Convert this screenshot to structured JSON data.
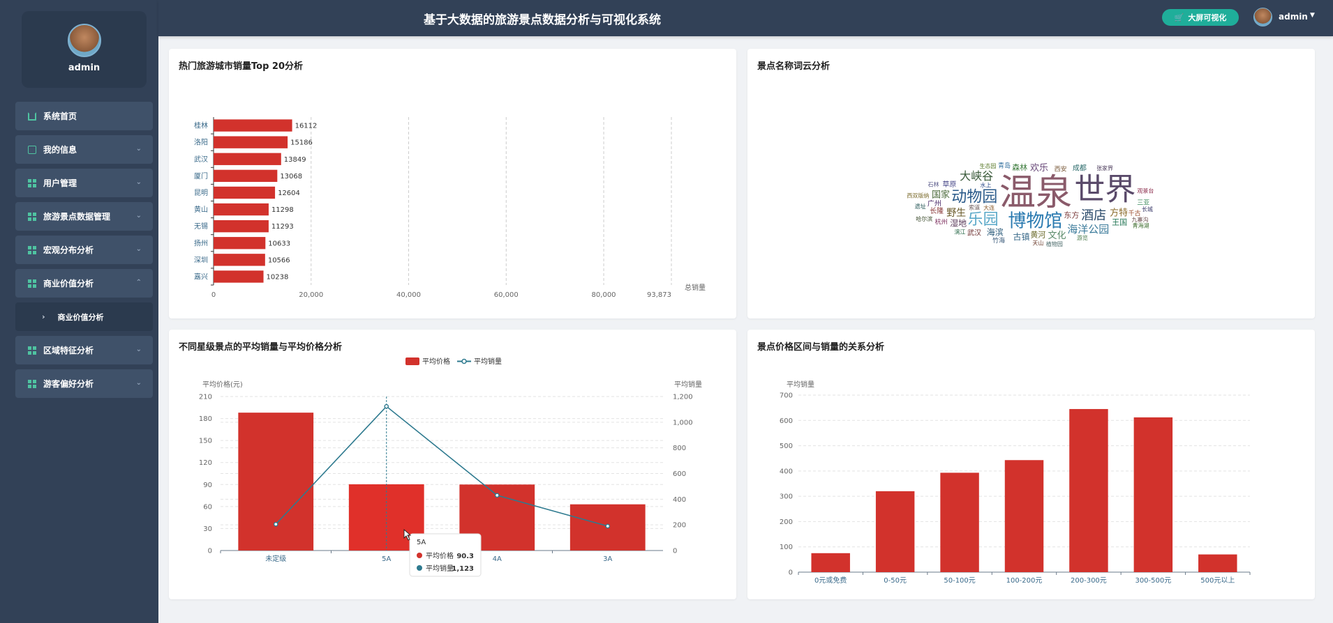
{
  "header": {
    "title": "基于大数据的旅游景点数据分析与可视化系统",
    "bigscreen_label": "大屏可视化",
    "user": "admin"
  },
  "sidebar": {
    "username": "admin",
    "items": [
      {
        "label": "系统首页",
        "icon": "home-icon",
        "expandable": false
      },
      {
        "label": "我的信息",
        "icon": "id-card-icon",
        "expandable": true
      },
      {
        "label": "用户管理",
        "icon": "grid-icon",
        "expandable": true
      },
      {
        "label": "旅游景点数据管理",
        "icon": "grid-icon",
        "expandable": true
      },
      {
        "label": "宏观分布分析",
        "icon": "grid-icon",
        "expandable": true
      },
      {
        "label": "商业价值分析",
        "icon": "grid-icon",
        "expandable": true,
        "expanded": true
      },
      {
        "label": "区域特征分析",
        "icon": "grid-icon",
        "expandable": true
      },
      {
        "label": "游客偏好分析",
        "icon": "grid-icon",
        "expandable": true
      }
    ],
    "submenu": {
      "label": "商业价值分析"
    }
  },
  "colors": {
    "bar": "#d2322c",
    "line": "#2e7a8f",
    "accent": "#1fae9a",
    "sidebar": "#324157"
  },
  "panels": {
    "city_sales": {
      "title": "热门旅游城市销量Top 20分析"
    },
    "wordcloud": {
      "title": "景点名称词云分析"
    },
    "star_level": {
      "title": "不同星级景点的平均销量与平均价格分析"
    },
    "price_range": {
      "title": "景点价格区间与销量的关系分析"
    }
  },
  "chart_data": [
    {
      "type": "bar",
      "orientation": "horizontal",
      "title": "热门旅游城市销量Top 20分析",
      "categories": [
        "嘉兴",
        "深圳",
        "扬州",
        "无锡",
        "黄山",
        "昆明",
        "厦门",
        "武汉",
        "洛阳",
        "桂林"
      ],
      "values": [
        10238,
        10566,
        10633,
        11293,
        11298,
        12604,
        13068,
        13849,
        15186,
        16112
      ],
      "xlabel": "总销量",
      "xlim": [
        0,
        93873
      ],
      "xticks": [
        "0",
        "20,000",
        "40,000",
        "60,000",
        "80,000",
        "93,873"
      ],
      "grid": true
    },
    {
      "type": "bar",
      "title": "不同星级景点的平均销量与平均价格分析",
      "categories": [
        "未定级",
        "5A",
        "4A",
        "3A"
      ],
      "series": [
        {
          "name": "平均价格",
          "type": "bar",
          "axis": "left",
          "values": [
            188,
            90.3,
            90,
            63
          ]
        },
        {
          "name": "平均销量",
          "type": "line",
          "axis": "right",
          "values": [
            205,
            1123,
            430,
            190
          ]
        }
      ],
      "ylabel_left": "平均价格(元)",
      "ylabel_right": "平均销量",
      "ylim_left": [
        0,
        210
      ],
      "yticks_left": [
        "0",
        "30",
        "60",
        "90",
        "120",
        "150",
        "180",
        "210"
      ],
      "ylim_right": [
        0,
        1200
      ],
      "yticks_right": [
        "0",
        "200",
        "400",
        "600",
        "800",
        "1,000",
        "1,200"
      ],
      "legend": "top-center",
      "tooltip": {
        "title": "5A",
        "rows": [
          {
            "name": "平均价格",
            "value": "90.3"
          },
          {
            "name": "平均销量",
            "value": "1,123"
          }
        ]
      }
    },
    {
      "type": "bar",
      "title": "景点价格区间与销量的关系分析",
      "categories": [
        "0元或免费",
        "0-50元",
        "50-100元",
        "100-200元",
        "200-300元",
        "300-500元",
        "500元以上"
      ],
      "values": [
        75,
        320,
        393,
        443,
        645,
        612,
        70
      ],
      "ylabel": "平均销量",
      "ylim": [
        0,
        700
      ],
      "yticks": [
        "0",
        "100",
        "200",
        "300",
        "400",
        "500",
        "600",
        "700"
      ],
      "grid": true
    }
  ],
  "wordcloud": {
    "words": [
      {
        "text": "温泉",
        "size": 52,
        "color": "#8a5a6a"
      },
      {
        "text": "世界",
        "size": 44,
        "color": "#5a4a6a"
      },
      {
        "text": "博物馆",
        "size": 26,
        "color": "#2a7ab0"
      },
      {
        "text": "动物园",
        "size": 22,
        "color": "#2a5a8a"
      },
      {
        "text": "乐园",
        "size": 22,
        "color": "#5aa8c8"
      },
      {
        "text": "酒店",
        "size": 18,
        "color": "#2a4a6a"
      },
      {
        "text": "大峡谷",
        "size": 16,
        "color": "#3a5a3a"
      },
      {
        "text": "海洋公园",
        "size": 15,
        "color": "#3a7a9a"
      },
      {
        "text": "野生",
        "size": 14,
        "color": "#6a5a2a"
      },
      {
        "text": "方特",
        "size": 13,
        "color": "#8a6a2a"
      },
      {
        "text": "文化",
        "size": 13,
        "color": "#5a8a6a"
      },
      {
        "text": "国家",
        "size": 13,
        "color": "#4a6a3a"
      },
      {
        "text": "欢乐",
        "size": 13,
        "color": "#6a4a7a"
      },
      {
        "text": "古镇",
        "size": 12,
        "color": "#3a6a8a"
      },
      {
        "text": "湿地",
        "size": 12,
        "color": "#5a3a5a"
      },
      {
        "text": "海滨",
        "size": 12,
        "color": "#2a5a7a"
      },
      {
        "text": "黄河",
        "size": 11,
        "color": "#6a6a2a"
      },
      {
        "text": "东方",
        "size": 11,
        "color": "#7a3a3a"
      },
      {
        "text": "森林",
        "size": 11,
        "color": "#3a7a3a"
      },
      {
        "text": "王国",
        "size": 11,
        "color": "#2a7a5a"
      },
      {
        "text": "长隆",
        "size": 10,
        "color": "#8a3a3a"
      },
      {
        "text": "草原",
        "size": 10,
        "color": "#4a4a8a"
      },
      {
        "text": "武汉",
        "size": 10,
        "color": "#6a2a2a"
      },
      {
        "text": "成都",
        "size": 10,
        "color": "#2a6a6a"
      },
      {
        "text": "广州",
        "size": 10,
        "color": "#4a2a6a"
      },
      {
        "text": "青岛",
        "size": 9,
        "color": "#2a6a9a"
      },
      {
        "text": "西安",
        "size": 9,
        "color": "#7a5a3a"
      },
      {
        "text": "三亚",
        "size": 9,
        "color": "#3a8a5a"
      },
      {
        "text": "杭州",
        "size": 9,
        "color": "#7a2a5a"
      },
      {
        "text": "千古",
        "size": 9,
        "color": "#9a4a2a"
      },
      {
        "text": "竹海",
        "size": 9,
        "color": "#3a5a7a"
      },
      {
        "text": "游览",
        "size": 8,
        "color": "#4a7a4a"
      },
      {
        "text": "索道",
        "size": 8,
        "color": "#6a5a5a"
      },
      {
        "text": "水上",
        "size": 8,
        "color": "#2a4a8a"
      },
      {
        "text": "生态园",
        "size": 8,
        "color": "#5a7a2a"
      },
      {
        "text": "观景台",
        "size": 8,
        "color": "#8a2a4a"
      },
      {
        "text": "长城",
        "size": 8,
        "color": "#3a3a6a"
      },
      {
        "text": "天山",
        "size": 8,
        "color": "#6a3a2a"
      },
      {
        "text": "漓江",
        "size": 8,
        "color": "#2a6a4a"
      },
      {
        "text": "西双版纳",
        "size": 8,
        "color": "#7a6a2a"
      },
      {
        "text": "张家界",
        "size": 8,
        "color": "#4a3a5a"
      },
      {
        "text": "石林",
        "size": 8,
        "color": "#5a5a8a"
      },
      {
        "text": "哈尔滨",
        "size": 8,
        "color": "#3a4a2a"
      },
      {
        "text": "九寨沟",
        "size": 8,
        "color": "#6a4a4a"
      },
      {
        "text": "遗址",
        "size": 8,
        "color": "#2a5a5a"
      },
      {
        "text": "大连",
        "size": 8,
        "color": "#8a5a2a"
      },
      {
        "text": "植物园",
        "size": 8,
        "color": "#4a6a6a"
      },
      {
        "text": "青海湖",
        "size": 8,
        "color": "#3a6a2a"
      }
    ]
  }
}
